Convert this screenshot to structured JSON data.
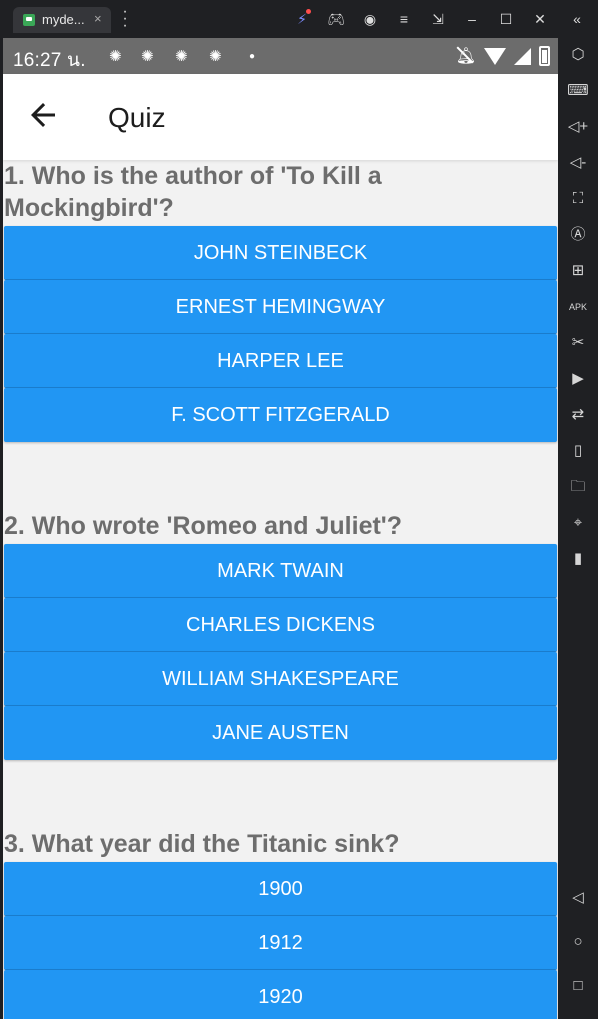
{
  "window": {
    "tab_title": "myde...",
    "tab_close": "×",
    "menu": "⋮"
  },
  "status": {
    "time": "16:27 น."
  },
  "appbar": {
    "title": "Quiz"
  },
  "quiz": [
    {
      "question": "1. Who is the author of 'To Kill a Mockingbird'?",
      "answers": [
        "JOHN STEINBECK",
        "ERNEST HEMINGWAY",
        "HARPER LEE",
        "F. SCOTT FITZGERALD"
      ]
    },
    {
      "question": "2. Who wrote 'Romeo and Juliet'?",
      "answers": [
        "MARK TWAIN",
        "CHARLES DICKENS",
        "WILLIAM SHAKESPEARE",
        "JANE AUSTEN"
      ]
    },
    {
      "question": "3. What year did the Titanic sink?",
      "answers": [
        "1900",
        "1912",
        "1920"
      ]
    }
  ],
  "colors": {
    "button": "#2196f3",
    "question_text": "#6d6d6d",
    "background": "#f2f2f2",
    "statusbar": "#6c6c6c"
  },
  "icons": {
    "back": "arrow-left-icon",
    "sidebar": [
      "power-icon",
      "keyboard-icon",
      "volume-up-icon",
      "volume-down-icon",
      "screenshot-icon",
      "rotate-icon",
      "add-screen-icon",
      "apk-icon",
      "cut-icon",
      "record-icon",
      "swap-icon",
      "shake-icon",
      "folder-icon",
      "location-icon",
      "vibrate-icon",
      "back-nav-icon",
      "home-nav-icon",
      "recents-nav-icon"
    ]
  }
}
